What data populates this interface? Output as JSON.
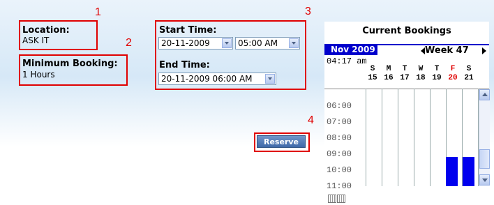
{
  "location": {
    "label": "Location:",
    "value": "ASK IT"
  },
  "min_booking": {
    "label": "Minimum Booking:",
    "value": "1 Hours"
  },
  "start_time": {
    "label": "Start Time:",
    "date": "20-11-2009",
    "time": "05:00 AM"
  },
  "end_time": {
    "label": "End Time:",
    "value": "20-11-2009 06:00 AM"
  },
  "reserve_label": "Reserve",
  "annotations": [
    "1",
    "2",
    "3",
    "4"
  ],
  "calendar": {
    "title": "Current Bookings",
    "month": "Nov 2009",
    "week": "Week 47",
    "current_time": "04:17 am",
    "days": [
      {
        "letter": "S",
        "num": "15",
        "highlight": false
      },
      {
        "letter": "M",
        "num": "16",
        "highlight": false
      },
      {
        "letter": "T",
        "num": "17",
        "highlight": false
      },
      {
        "letter": "W",
        "num": "18",
        "highlight": false
      },
      {
        "letter": "T",
        "num": "19",
        "highlight": false
      },
      {
        "letter": "F",
        "num": "20",
        "highlight": true
      },
      {
        "letter": "S",
        "num": "21",
        "highlight": false
      }
    ],
    "hours": [
      "06:00",
      "07:00",
      "08:00",
      "09:00",
      "10:00",
      "11:00"
    ],
    "highlight_color": "#e00000",
    "booking_color": "#0000ee"
  }
}
